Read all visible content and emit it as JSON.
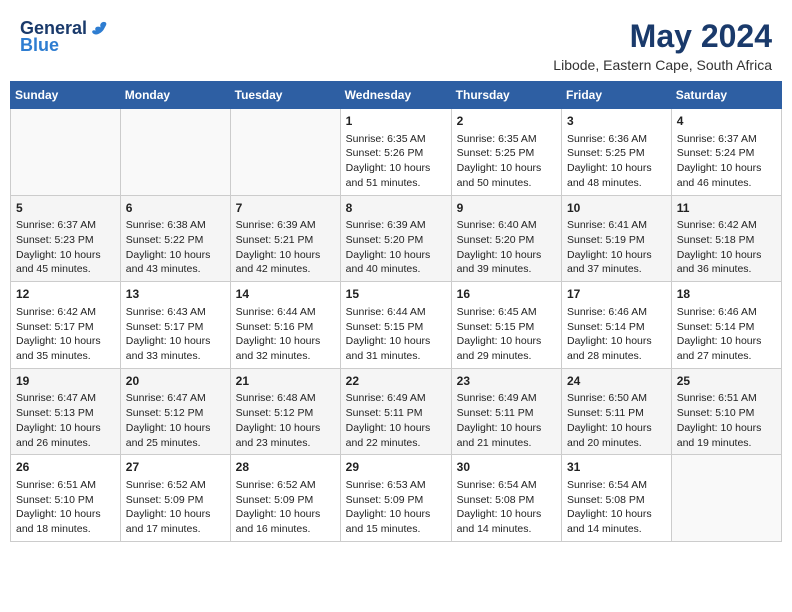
{
  "header": {
    "logo_general": "General",
    "logo_blue": "Blue",
    "title": "May 2024",
    "subtitle": "Libode, Eastern Cape, South Africa"
  },
  "calendar": {
    "days_of_week": [
      "Sunday",
      "Monday",
      "Tuesday",
      "Wednesday",
      "Thursday",
      "Friday",
      "Saturday"
    ],
    "weeks": [
      [
        {
          "day": "",
          "info": ""
        },
        {
          "day": "",
          "info": ""
        },
        {
          "day": "",
          "info": ""
        },
        {
          "day": "1",
          "info": "Sunrise: 6:35 AM\nSunset: 5:26 PM\nDaylight: 10 hours\nand 51 minutes."
        },
        {
          "day": "2",
          "info": "Sunrise: 6:35 AM\nSunset: 5:25 PM\nDaylight: 10 hours\nand 50 minutes."
        },
        {
          "day": "3",
          "info": "Sunrise: 6:36 AM\nSunset: 5:25 PM\nDaylight: 10 hours\nand 48 minutes."
        },
        {
          "day": "4",
          "info": "Sunrise: 6:37 AM\nSunset: 5:24 PM\nDaylight: 10 hours\nand 46 minutes."
        }
      ],
      [
        {
          "day": "5",
          "info": "Sunrise: 6:37 AM\nSunset: 5:23 PM\nDaylight: 10 hours\nand 45 minutes."
        },
        {
          "day": "6",
          "info": "Sunrise: 6:38 AM\nSunset: 5:22 PM\nDaylight: 10 hours\nand 43 minutes."
        },
        {
          "day": "7",
          "info": "Sunrise: 6:39 AM\nSunset: 5:21 PM\nDaylight: 10 hours\nand 42 minutes."
        },
        {
          "day": "8",
          "info": "Sunrise: 6:39 AM\nSunset: 5:20 PM\nDaylight: 10 hours\nand 40 minutes."
        },
        {
          "day": "9",
          "info": "Sunrise: 6:40 AM\nSunset: 5:20 PM\nDaylight: 10 hours\nand 39 minutes."
        },
        {
          "day": "10",
          "info": "Sunrise: 6:41 AM\nSunset: 5:19 PM\nDaylight: 10 hours\nand 37 minutes."
        },
        {
          "day": "11",
          "info": "Sunrise: 6:42 AM\nSunset: 5:18 PM\nDaylight: 10 hours\nand 36 minutes."
        }
      ],
      [
        {
          "day": "12",
          "info": "Sunrise: 6:42 AM\nSunset: 5:17 PM\nDaylight: 10 hours\nand 35 minutes."
        },
        {
          "day": "13",
          "info": "Sunrise: 6:43 AM\nSunset: 5:17 PM\nDaylight: 10 hours\nand 33 minutes."
        },
        {
          "day": "14",
          "info": "Sunrise: 6:44 AM\nSunset: 5:16 PM\nDaylight: 10 hours\nand 32 minutes."
        },
        {
          "day": "15",
          "info": "Sunrise: 6:44 AM\nSunset: 5:15 PM\nDaylight: 10 hours\nand 31 minutes."
        },
        {
          "day": "16",
          "info": "Sunrise: 6:45 AM\nSunset: 5:15 PM\nDaylight: 10 hours\nand 29 minutes."
        },
        {
          "day": "17",
          "info": "Sunrise: 6:46 AM\nSunset: 5:14 PM\nDaylight: 10 hours\nand 28 minutes."
        },
        {
          "day": "18",
          "info": "Sunrise: 6:46 AM\nSunset: 5:14 PM\nDaylight: 10 hours\nand 27 minutes."
        }
      ],
      [
        {
          "day": "19",
          "info": "Sunrise: 6:47 AM\nSunset: 5:13 PM\nDaylight: 10 hours\nand 26 minutes."
        },
        {
          "day": "20",
          "info": "Sunrise: 6:47 AM\nSunset: 5:12 PM\nDaylight: 10 hours\nand 25 minutes."
        },
        {
          "day": "21",
          "info": "Sunrise: 6:48 AM\nSunset: 5:12 PM\nDaylight: 10 hours\nand 23 minutes."
        },
        {
          "day": "22",
          "info": "Sunrise: 6:49 AM\nSunset: 5:11 PM\nDaylight: 10 hours\nand 22 minutes."
        },
        {
          "day": "23",
          "info": "Sunrise: 6:49 AM\nSunset: 5:11 PM\nDaylight: 10 hours\nand 21 minutes."
        },
        {
          "day": "24",
          "info": "Sunrise: 6:50 AM\nSunset: 5:11 PM\nDaylight: 10 hours\nand 20 minutes."
        },
        {
          "day": "25",
          "info": "Sunrise: 6:51 AM\nSunset: 5:10 PM\nDaylight: 10 hours\nand 19 minutes."
        }
      ],
      [
        {
          "day": "26",
          "info": "Sunrise: 6:51 AM\nSunset: 5:10 PM\nDaylight: 10 hours\nand 18 minutes."
        },
        {
          "day": "27",
          "info": "Sunrise: 6:52 AM\nSunset: 5:09 PM\nDaylight: 10 hours\nand 17 minutes."
        },
        {
          "day": "28",
          "info": "Sunrise: 6:52 AM\nSunset: 5:09 PM\nDaylight: 10 hours\nand 16 minutes."
        },
        {
          "day": "29",
          "info": "Sunrise: 6:53 AM\nSunset: 5:09 PM\nDaylight: 10 hours\nand 15 minutes."
        },
        {
          "day": "30",
          "info": "Sunrise: 6:54 AM\nSunset: 5:08 PM\nDaylight: 10 hours\nand 14 minutes."
        },
        {
          "day": "31",
          "info": "Sunrise: 6:54 AM\nSunset: 5:08 PM\nDaylight: 10 hours\nand 14 minutes."
        },
        {
          "day": "",
          "info": ""
        }
      ]
    ]
  }
}
